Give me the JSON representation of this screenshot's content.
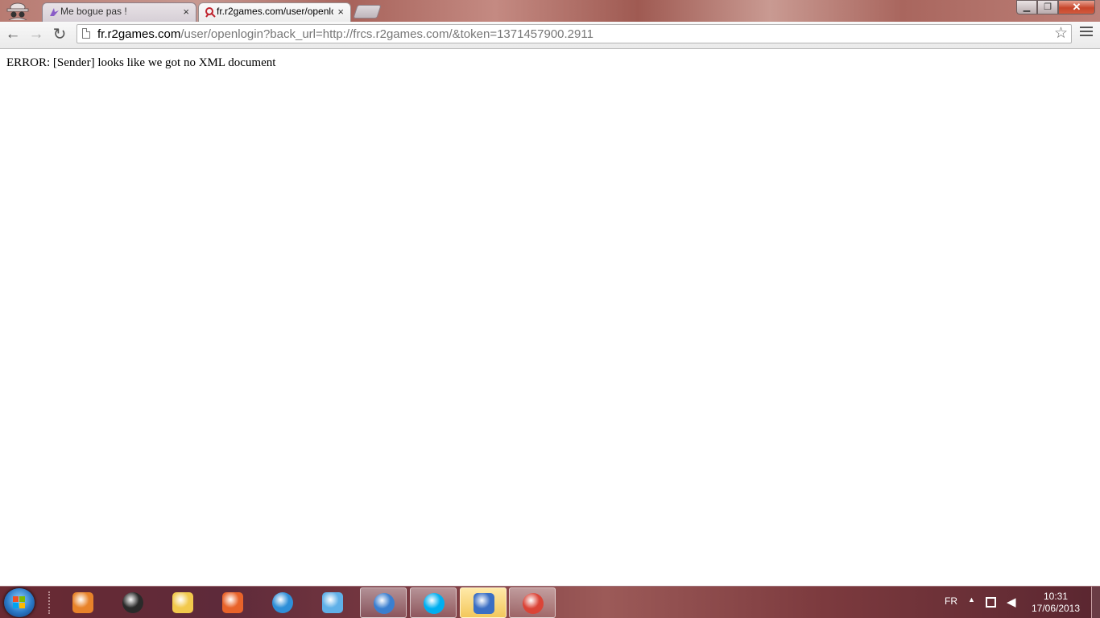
{
  "browser": {
    "tabs": [
      {
        "label": "Me bogue pas !",
        "favicon": "purple-bird-icon",
        "active": false
      },
      {
        "label": "fr.r2games.com/user/openlogin?back_url=http://frcs.r2games.com/&token=1371457900.2911",
        "favicon": "r2games-icon",
        "active": true
      }
    ],
    "tab_close_glyph": "×",
    "window_controls": {
      "minimize": "▁",
      "maximize": "❐",
      "close": "✕"
    },
    "toolbar": {
      "back_glyph": "←",
      "forward_glyph": "→",
      "reload_glyph": "↻",
      "url_host": "fr.r2games.com",
      "url_path": "/user/openlogin?back_url=http://frcs.r2games.com/&token=1371457900.2911",
      "bookmark_glyph": "☆"
    }
  },
  "page": {
    "error_text": "ERROR: [Sender] looks like we got no XML document"
  },
  "taskbar": {
    "pinned": [
      {
        "name": "media-player-icon",
        "color": "#e8832a",
        "state": "normal"
      },
      {
        "name": "hp-icon",
        "color": "#2a2a2a",
        "state": "normal"
      },
      {
        "name": "file-explorer-icon",
        "color": "#f2c94c",
        "state": "normal"
      },
      {
        "name": "ms-paint-icon",
        "color": "#e8632a",
        "state": "normal"
      },
      {
        "name": "internet-explorer-icon",
        "color": "#2e8fd8",
        "state": "normal"
      },
      {
        "name": "messenger-icon",
        "color": "#5fb0e8",
        "state": "normal"
      },
      {
        "name": "search-icon",
        "color": "#3a7fd0",
        "state": "open"
      },
      {
        "name": "skype-icon",
        "color": "#00aff0",
        "state": "open"
      },
      {
        "name": "security-shield-icon",
        "color": "#3b6fc4",
        "state": "active"
      },
      {
        "name": "chrome-icon",
        "color": "#db4437",
        "state": "open"
      }
    ],
    "tray": {
      "language": "FR",
      "time": "10:31",
      "date": "17/06/2013"
    }
  }
}
